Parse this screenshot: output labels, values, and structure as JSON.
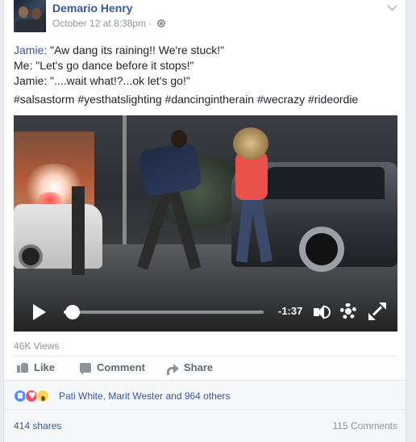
{
  "post": {
    "author": "Demario Henry",
    "timestamp": "October 12 at 8:38pm",
    "separator": "·",
    "lines": [
      {
        "name": "Jamie:",
        "text": " \"Aw dang its raining!! We're stuck!\""
      },
      {
        "name": "",
        "text": "Me: \"Let's go dance before it stops!\""
      },
      {
        "name": "",
        "text": "Jamie: \"....wait what!?...ok let's go!\""
      }
    ],
    "hashtags": "#salsastorm #yesthatslighting #dancingintherain #wecrazy #rideordie"
  },
  "video": {
    "time_remaining": "-1:37",
    "progress": 0.03
  },
  "views": "46K Views",
  "actions": {
    "like": "Like",
    "comment": "Comment",
    "share": "Share"
  },
  "reactions": {
    "names": "Pati White, Marit Wester and 964 others"
  },
  "stats": {
    "shares": "414 shares",
    "comments": "115 Comments"
  }
}
